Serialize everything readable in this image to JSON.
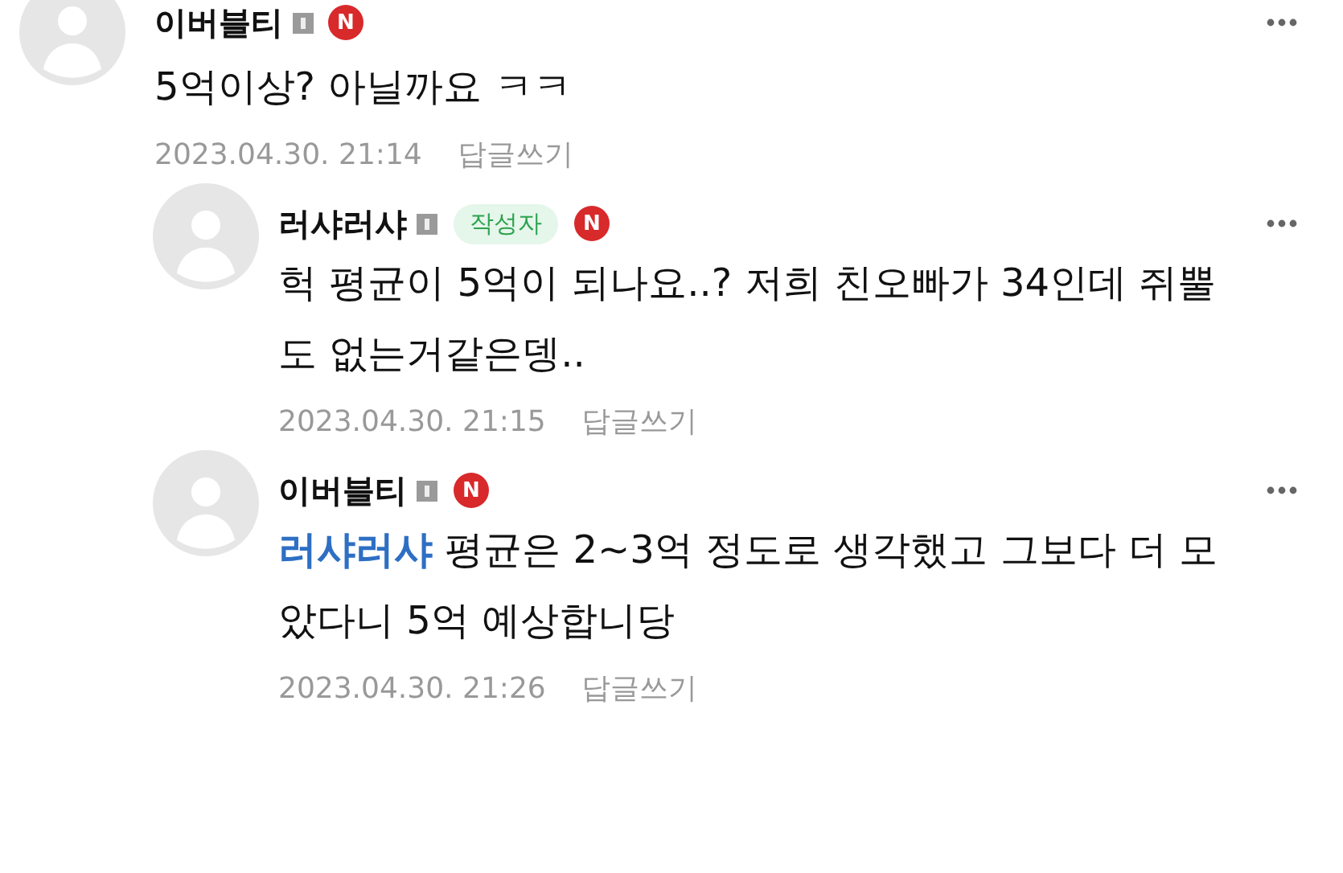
{
  "comments": [
    {
      "author": "이버블티",
      "new_badge": "N",
      "text": "5억이상? 아닐까요 ㅋㅋ",
      "date": "2023.04.30. 21:14",
      "reply_button": "답글쓰기",
      "children": [
        {
          "author": "러샤러샤",
          "author_tag": "작성자",
          "new_badge": "N",
          "text": "헉 평균이 5억이 되나요..? 저희 친오빠가 34인데 쥐뿔도 없는거같은뎅..",
          "date": "2023.04.30. 21:15",
          "reply_button": "답글쓰기"
        },
        {
          "author": "이버블티",
          "new_badge": "N",
          "mention": "러샤러샤",
          "text": "평균은 2~3억 정도로 생각했고 그보다 더 모았다니 5억 예상합니당",
          "date": "2023.04.30. 21:26",
          "reply_button": "답글쓰기"
        }
      ]
    }
  ]
}
